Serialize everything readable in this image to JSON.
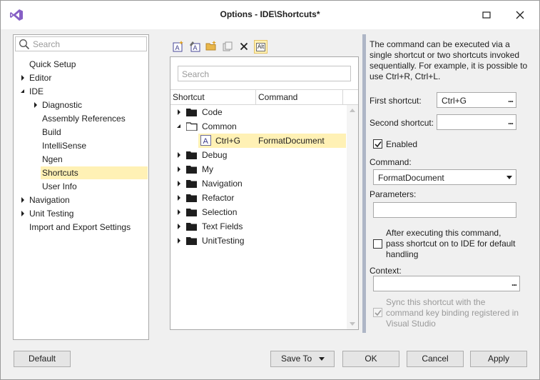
{
  "window": {
    "title": "Options - IDE\\Shortcuts*"
  },
  "nav": {
    "search_placeholder": "Search",
    "items": [
      {
        "label": "Quick Setup",
        "expander": "none"
      },
      {
        "label": "Editor",
        "expander": "collapsed"
      },
      {
        "label": "IDE",
        "expander": "expanded"
      },
      {
        "label": "Diagnostic",
        "expander": "collapsed"
      },
      {
        "label": "Assembly References",
        "expander": "none"
      },
      {
        "label": "Build",
        "expander": "none"
      },
      {
        "label": "IntelliSense",
        "expander": "none"
      },
      {
        "label": "Ngen",
        "expander": "none"
      },
      {
        "label": "Shortcuts",
        "expander": "none",
        "selected": true
      },
      {
        "label": "User Info",
        "expander": "none"
      },
      {
        "label": "Navigation",
        "expander": "collapsed"
      },
      {
        "label": "Unit Testing",
        "expander": "collapsed"
      },
      {
        "label": "Import and Export Settings",
        "expander": "none"
      }
    ]
  },
  "toolbar": {
    "icons": [
      "new-shortcut-icon",
      "rename-icon",
      "open-folder-icon",
      "copy-icon",
      "delete-icon",
      "alt-toggle-icon"
    ],
    "alt_label": "Alt"
  },
  "shortcuts": {
    "search_placeholder": "Search",
    "columns": [
      "Shortcut",
      "Command"
    ],
    "rows": [
      {
        "label": "Code",
        "expander": "collapsed"
      },
      {
        "label": "Common",
        "expander": "expanded"
      },
      {
        "shortcut": "Ctrl+G",
        "command": "FormatDocument",
        "selected": true
      },
      {
        "label": "Debug",
        "expander": "collapsed"
      },
      {
        "label": "My",
        "expander": "collapsed"
      },
      {
        "label": "Navigation",
        "expander": "collapsed"
      },
      {
        "label": "Refactor",
        "expander": "collapsed"
      },
      {
        "label": "Selection",
        "expander": "collapsed"
      },
      {
        "label": "Text Fields",
        "expander": "collapsed"
      },
      {
        "label": "UnitTesting",
        "expander": "collapsed"
      }
    ]
  },
  "details": {
    "description": "The command can be executed via a single shortcut or two shortcuts invoked sequentially. For example, it is possible to use Ctrl+R, Ctrl+L.",
    "first_shortcut_label": "First shortcut:",
    "first_shortcut_value": "Ctrl+G",
    "second_shortcut_label": "Second shortcut:",
    "second_shortcut_value": "",
    "enabled_label": "Enabled",
    "enabled_checked": true,
    "command_label": "Command:",
    "command_value": "FormatDocument",
    "parameters_label": "Parameters:",
    "parameters_value": "",
    "pass_label": "After executing this command, pass shortcut on to IDE for default handling",
    "pass_checked": false,
    "context_label": "Context:",
    "context_value": "",
    "sync_label": "Sync this shortcut with the command key binding registered in Visual Studio",
    "sync_checked": true,
    "browse_label": "..."
  },
  "buttons": {
    "default": "Default",
    "save_to": "Save To",
    "ok": "OK",
    "cancel": "Cancel",
    "apply": "Apply"
  },
  "colors": {
    "selection": "#fff1b5",
    "vs_purple": "#865fc5",
    "splitter": "#aeb6c6"
  }
}
